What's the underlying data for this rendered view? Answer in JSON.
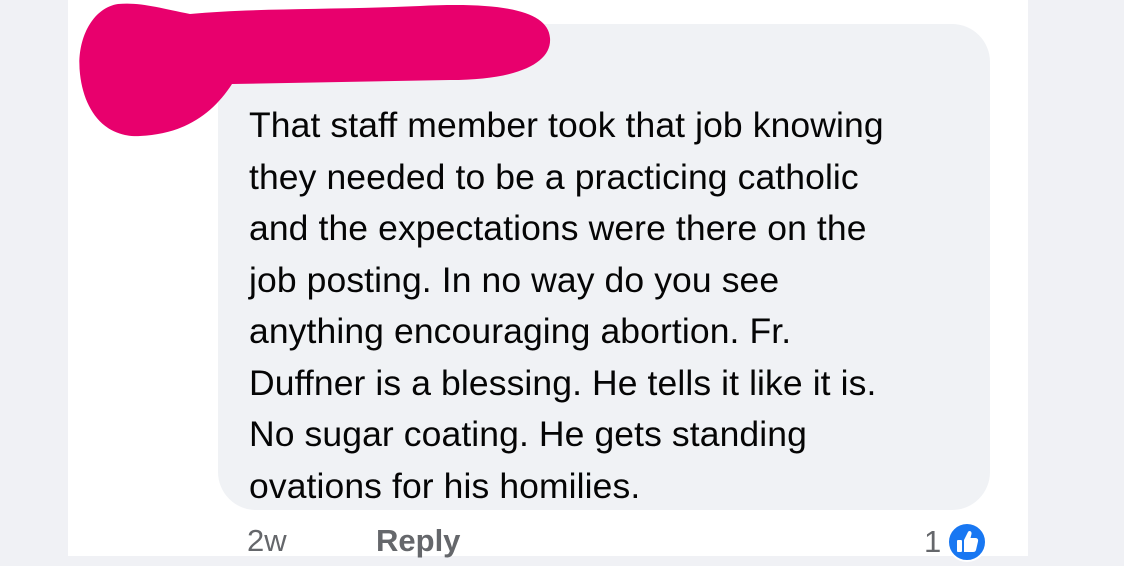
{
  "comment": {
    "text": "That staff member took that job knowing\nthey needed to be a practicing catholic\nand the expectations were there on the\njob posting. In no way do you see\nanything encouraging abortion. Fr.\nDuffner is a blessing.  He tells it like it is.\nNo sugar coating. He gets standing\novations for his homilies.",
    "author_redacted": true
  },
  "actions": {
    "timestamp": "2w",
    "reply_label": "Reply",
    "reaction_count": "1",
    "reaction_icon": "like-icon"
  },
  "colors": {
    "background": "#f0f1f5",
    "bubble": "#f0f2f5",
    "text": "#050505",
    "meta_text": "#65676b",
    "redaction": "#e8006d",
    "like_blue": "#1877f2"
  }
}
